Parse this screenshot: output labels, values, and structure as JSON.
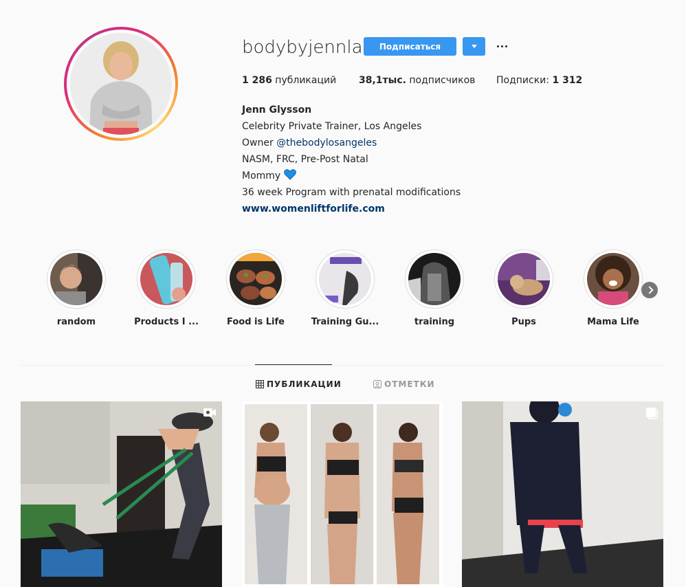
{
  "profile": {
    "username": "bodybyjennla",
    "follow_label": "Подписаться",
    "stats": {
      "posts_count": "1 286",
      "posts_label": "публикаций",
      "followers_count": "38,1тыс.",
      "followers_label": "подписчиков",
      "following_label": "Подписки:",
      "following_count": "1 312"
    },
    "bio": {
      "name": "Jenn Glysson",
      "line1": "Celebrity Private Trainer, Los Angeles",
      "owner_prefix": "Owner",
      "owner_handle": "@thebodylosangeles",
      "line3": "NASM, FRC, Pre-Post Natal",
      "line4": "Mommy",
      "line5": "36 week Program with prenatal modifications",
      "website": "www.womenliftforlife.com"
    }
  },
  "highlights": [
    {
      "label": "random"
    },
    {
      "label": "Products I ..."
    },
    {
      "label": "Food is Life"
    },
    {
      "label": "Training Gu..."
    },
    {
      "label": "training"
    },
    {
      "label": "Pups"
    },
    {
      "label": "Mama Life"
    }
  ],
  "tabs": {
    "posts": "ПУБЛИКАЦИИ",
    "tagged": "ОТМЕТКИ"
  },
  "colors": {
    "accent": "#3897f0",
    "link": "#003569",
    "heart": "#1f8fe0"
  },
  "icons": {
    "video": "video-icon",
    "carousel": "carousel-icon",
    "more": "more-dots-icon",
    "next": "chevron-right-icon"
  }
}
